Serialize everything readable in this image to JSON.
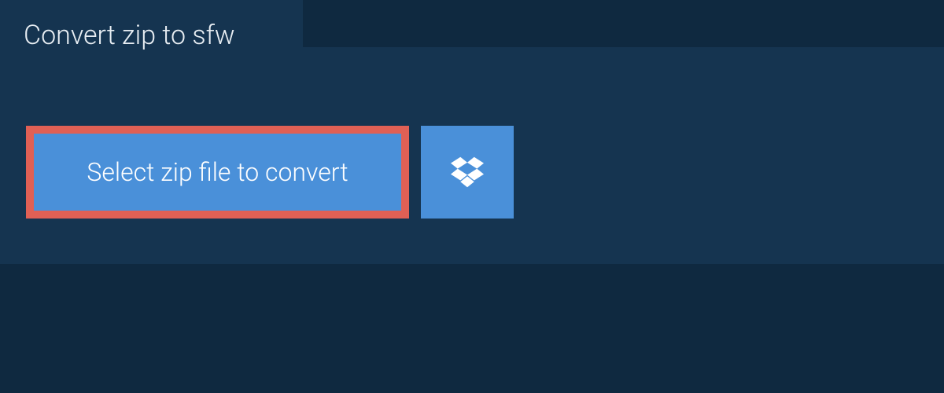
{
  "tab": {
    "label": "Convert zip to sfw"
  },
  "actions": {
    "select_file_label": "Select zip file to convert"
  }
}
